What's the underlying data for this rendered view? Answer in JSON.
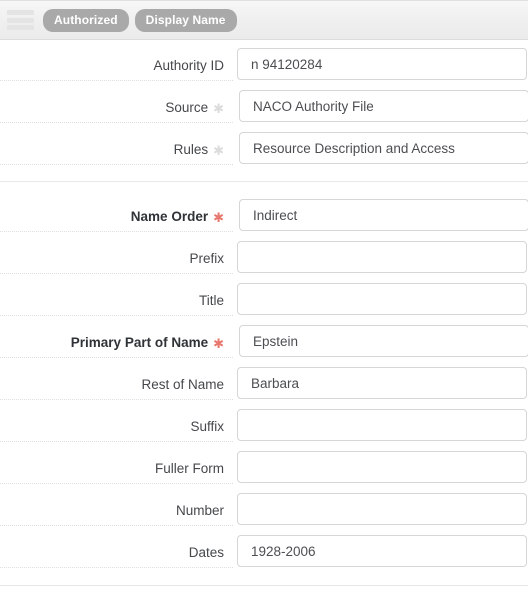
{
  "header": {
    "drag_handle_icon": "drag-handle-icon",
    "badges": [
      {
        "label": "Authorized"
      },
      {
        "label": "Display Name"
      }
    ]
  },
  "colors": {
    "badge_background": "#a9a9a9",
    "badge_text": "#ffffff",
    "required_marker": "#e8776e",
    "optional_marker": "#dcdcdc",
    "input_border": "#d6d6d6",
    "header_background": "#efefef",
    "divider": "#e7e7e7"
  },
  "form": {
    "groups": [
      {
        "name": "authority-group",
        "fields": [
          {
            "name": "authority-id",
            "label": "Authority ID",
            "required": false,
            "marker": "none",
            "value": "n 94120284",
            "placeholder": ""
          },
          {
            "name": "source",
            "label": "Source",
            "required": false,
            "marker": "optional",
            "value": "NACO Authority File",
            "placeholder": ""
          },
          {
            "name": "rules",
            "label": "Rules",
            "required": false,
            "marker": "optional",
            "value": "Resource Description and Access",
            "placeholder": ""
          }
        ]
      },
      {
        "name": "name-parts-group",
        "fields": [
          {
            "name": "name-order",
            "label": "Name Order",
            "required": true,
            "marker": "required",
            "value": "Indirect",
            "placeholder": ""
          },
          {
            "name": "prefix",
            "label": "Prefix",
            "required": false,
            "marker": "none",
            "value": "",
            "placeholder": ""
          },
          {
            "name": "title",
            "label": "Title",
            "required": false,
            "marker": "none",
            "value": "",
            "placeholder": ""
          },
          {
            "name": "primary-part-of-name",
            "label": "Primary Part of Name",
            "required": true,
            "marker": "required",
            "value": "Epstein",
            "placeholder": ""
          },
          {
            "name": "rest-of-name",
            "label": "Rest of Name",
            "required": false,
            "marker": "none",
            "value": "Barbara",
            "placeholder": ""
          },
          {
            "name": "suffix",
            "label": "Suffix",
            "required": false,
            "marker": "none",
            "value": "",
            "placeholder": ""
          },
          {
            "name": "fuller-form",
            "label": "Fuller Form",
            "required": false,
            "marker": "none",
            "value": "",
            "placeholder": ""
          },
          {
            "name": "number",
            "label": "Number",
            "required": false,
            "marker": "none",
            "value": "",
            "placeholder": ""
          },
          {
            "name": "dates",
            "label": "Dates",
            "required": false,
            "marker": "none",
            "value": "1928-2006",
            "placeholder": ""
          }
        ]
      }
    ]
  }
}
